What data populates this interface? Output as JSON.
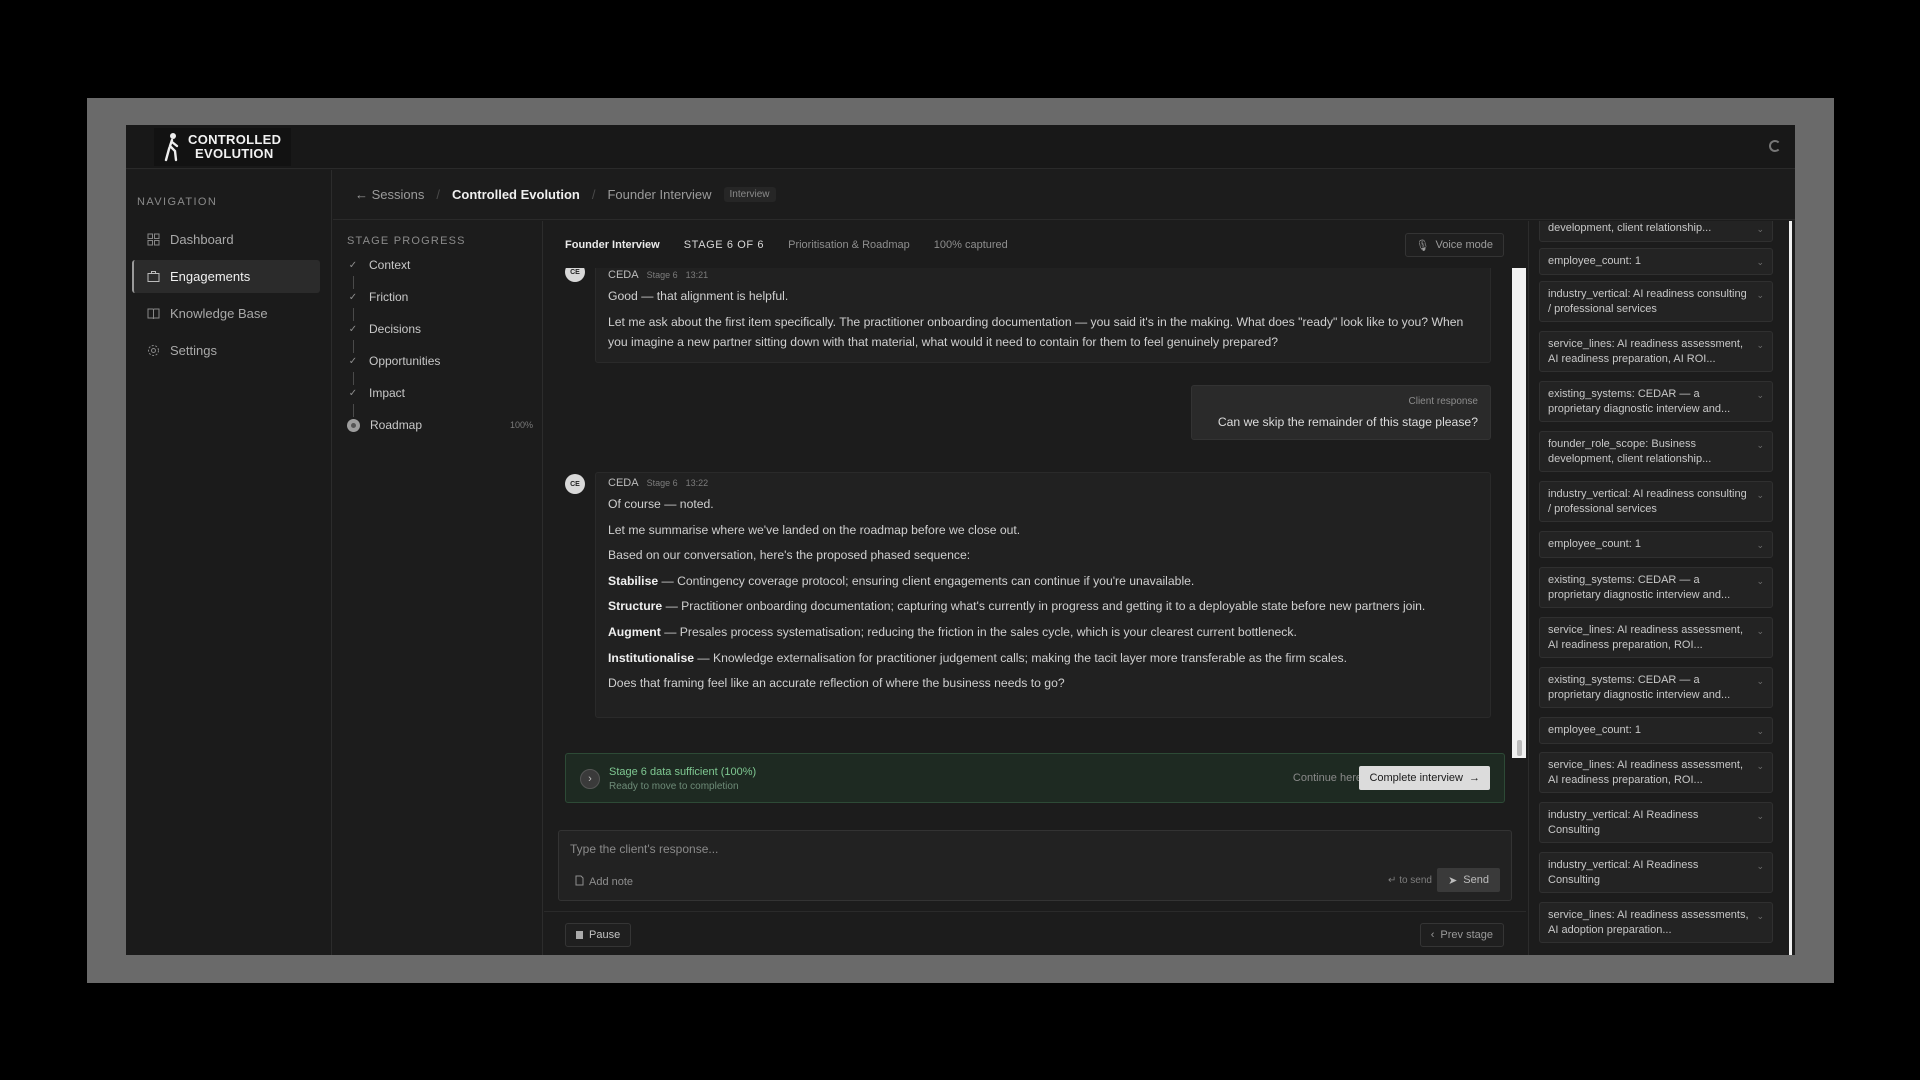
{
  "brand": {
    "line1": "CONTROLLED",
    "line2": "EVOLUTION"
  },
  "nav": {
    "title": "NAVIGATION",
    "items": [
      {
        "label": "Dashboard",
        "icon": "dashboard-icon"
      },
      {
        "label": "Engagements",
        "icon": "briefcase-icon",
        "active": true
      },
      {
        "label": "Knowledge Base",
        "icon": "book-icon"
      },
      {
        "label": "Settings",
        "icon": "gear-icon"
      }
    ]
  },
  "breadcrumb": {
    "back": "Sessions",
    "project": "Controlled Evolution",
    "page": "Founder Interview",
    "tag": "Interview"
  },
  "stages": {
    "title": "STAGE PROGRESS",
    "items": [
      {
        "label": "Context",
        "state": "done"
      },
      {
        "label": "Friction",
        "state": "done"
      },
      {
        "label": "Decisions",
        "state": "done"
      },
      {
        "label": "Opportunities",
        "state": "done"
      },
      {
        "label": "Impact",
        "state": "done"
      },
      {
        "label": "Roadmap",
        "state": "current",
        "pct": "100%"
      }
    ]
  },
  "chat_header": {
    "title": "Founder Interview",
    "stage": "STAGE 6 OF 6",
    "topic": "Prioritisation & Roadmap",
    "captured": "100% captured",
    "voice_label": "Voice mode"
  },
  "messages": {
    "m1": {
      "avatar": "CE",
      "sender": "CEDA",
      "stage": "Stage 6",
      "time": "13:21",
      "p1": "Good — that alignment is helpful.",
      "p2": "Let me ask about the first item specifically. The practitioner onboarding documentation — you said it's in the making. What does \"ready\" look like to you? When you imagine a new partner sitting down with that material, what would it need to contain for them to feel genuinely prepared?"
    },
    "client": {
      "label": "Client response",
      "text": "Can we skip the remainder of this stage please?"
    },
    "m2": {
      "avatar": "CE",
      "sender": "CEDA",
      "stage": "Stage 6",
      "time": "13:22",
      "p1": "Of course — noted.",
      "p2": "Let me summarise where we've landed on the roadmap before we close out.",
      "p3": "Based on our conversation, here's the proposed phased sequence:",
      "items": [
        {
          "term": "Stabilise",
          "text": " — Contingency coverage protocol; ensuring client engagements can continue if you're unavailable."
        },
        {
          "term": "Structure",
          "text": " — Practitioner onboarding documentation; capturing what's currently in progress and getting it to a deployable state before new partners join."
        },
        {
          "term": "Augment",
          "text": " — Presales process systematisation; reducing the friction in the sales cycle, which is your clearest current bottleneck."
        },
        {
          "term": "Institutionalise",
          "text": " — Knowledge externalisation for practitioner judgement calls; making the tacit layer more transferable as the firm scales."
        }
      ],
      "p4": "Does that framing feel like an accurate reflection of where the business needs to go?"
    }
  },
  "banner": {
    "title": "Stage 6 data sufficient (100%)",
    "subtitle": "Ready to move to completion",
    "continue_label": "Continue here",
    "complete_label": "Complete interview"
  },
  "composer": {
    "placeholder": "Type the client's response...",
    "add_note": "Add note",
    "hint": "↵ to send",
    "send_label": "Send"
  },
  "footer": {
    "pause_label": "Pause",
    "prev_label": "Prev stage"
  },
  "facts": [
    "development, client relationship...",
    "employee_count: 1",
    "industry_vertical: AI readiness consulting / professional services",
    "service_lines: AI readiness assessment, AI readiness preparation, AI ROI...",
    "existing_systems: CEDAR — a proprietary diagnostic interview and...",
    "founder_role_scope: Business development, client relationship...",
    "industry_vertical: AI readiness consulting / professional services",
    "employee_count: 1",
    "existing_systems: CEDAR — a proprietary diagnostic interview and...",
    "service_lines: AI readiness assessment, AI readiness preparation, ROI...",
    "existing_systems: CEDAR — a proprietary diagnostic interview and...",
    "employee_count: 1",
    "service_lines: AI readiness assessment, AI readiness preparation, ROI...",
    "industry_vertical: AI Readiness Consulting",
    "industry_vertical: AI Readiness Consulting",
    "service_lines: AI readiness assessments, AI adoption preparation..."
  ]
}
